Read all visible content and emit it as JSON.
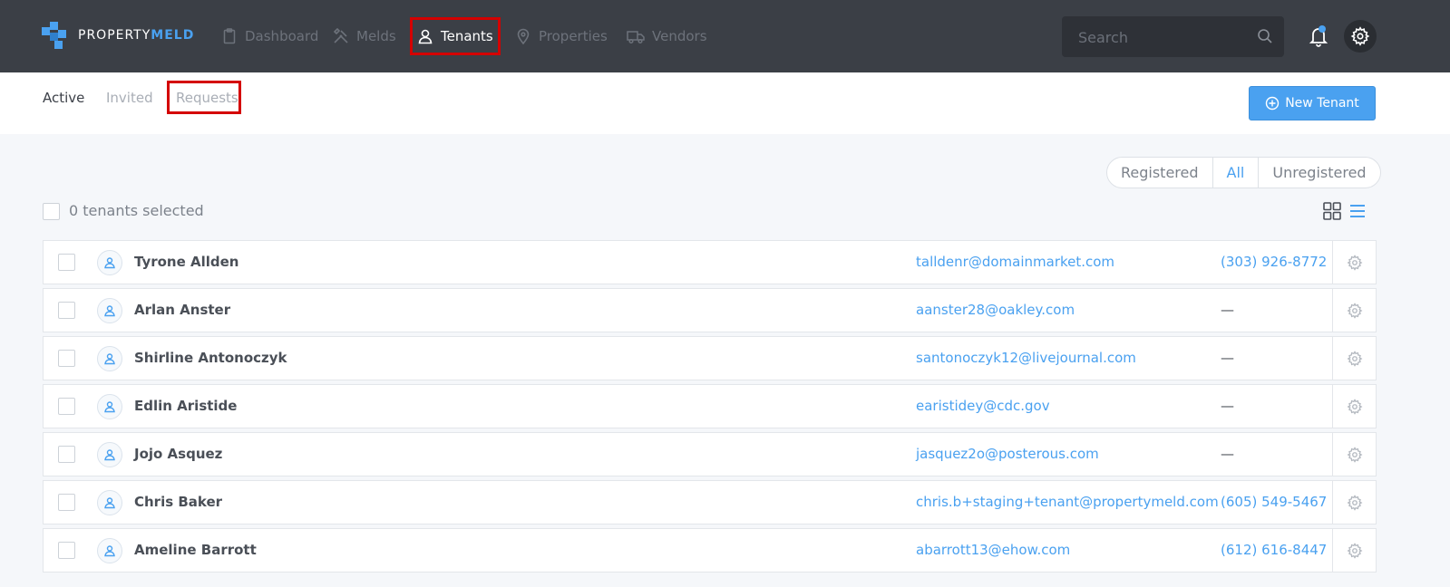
{
  "brand": {
    "name_plain": "PROPERTY",
    "name_bold": "MELD",
    "accent": "#4aa1f0"
  },
  "nav": {
    "items": [
      {
        "label": "Dashboard",
        "icon": "clipboard-icon"
      },
      {
        "label": "Melds",
        "icon": "tools-icon"
      },
      {
        "label": "Tenants",
        "icon": "person-icon",
        "active": true
      },
      {
        "label": "Properties",
        "icon": "map-pin-icon"
      },
      {
        "label": "Vendors",
        "icon": "truck-icon"
      }
    ]
  },
  "search": {
    "placeholder": "Search",
    "value": ""
  },
  "subnav": {
    "tabs": [
      {
        "label": "Active",
        "active": true
      },
      {
        "label": "Invited"
      },
      {
        "label": "Requests"
      }
    ],
    "new_tenant_label": "New Tenant"
  },
  "filters": {
    "options": [
      "Registered",
      "All",
      "Unregistered"
    ],
    "selected": "All"
  },
  "selection": {
    "text": "0 tenants selected"
  },
  "tenants": [
    {
      "name": "Tyrone Allden",
      "email": "talldenr@domainmarket.com",
      "phone": "(303) 926-8772"
    },
    {
      "name": "Arlan Anster",
      "email": "aanster28@oakley.com",
      "phone": "—"
    },
    {
      "name": "Shirline Antonoczyk",
      "email": "santonoczyk12@livejournal.com",
      "phone": "—"
    },
    {
      "name": "Edlin Aristide",
      "email": "earistidey@cdc.gov",
      "phone": "—"
    },
    {
      "name": "Jojo Asquez",
      "email": "jasquez2o@posterous.com",
      "phone": "—"
    },
    {
      "name": "Chris Baker",
      "email": "chris.b+staging+tenant@propertymeld.com",
      "phone": "(605) 549-5467"
    },
    {
      "name": "Ameline Barrott",
      "email": "abarrott13@ehow.com",
      "phone": "(612) 616-8447"
    }
  ]
}
